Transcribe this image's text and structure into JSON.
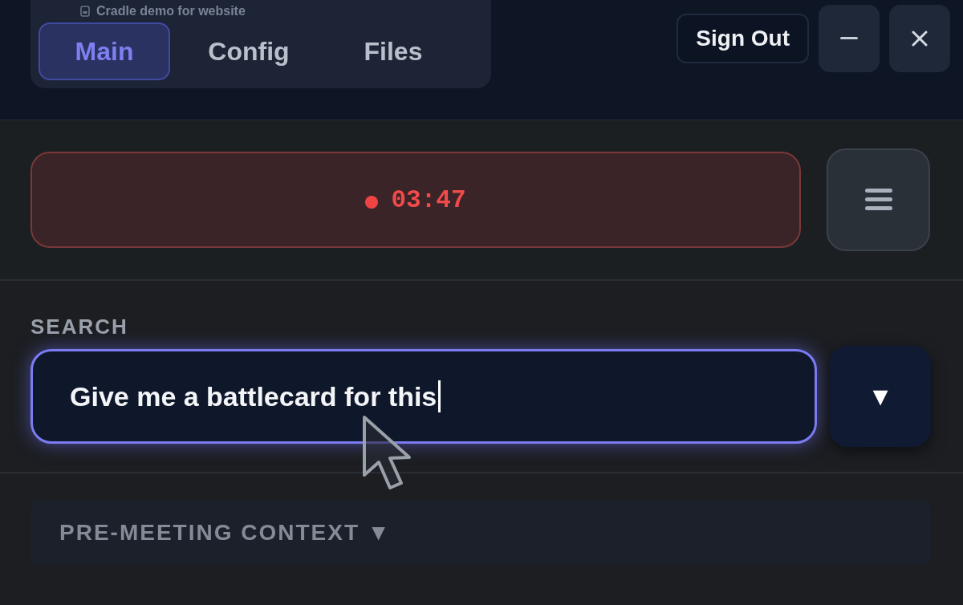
{
  "window": {
    "title": "Cradle demo for website"
  },
  "tabs": [
    {
      "label": "Main",
      "selected": true
    },
    {
      "label": "Config",
      "selected": false
    },
    {
      "label": "Files",
      "selected": false
    }
  ],
  "sign_out": {
    "label": "Sign Out"
  },
  "recording": {
    "active": true,
    "timer": "03:47"
  },
  "search": {
    "label": "SEARCH",
    "value": "Give me a battlecard for this",
    "focused": true,
    "dropdown": "▼"
  },
  "context": {
    "title": "PRE-MEETING CONTEXT",
    "toggle": "▼"
  }
}
